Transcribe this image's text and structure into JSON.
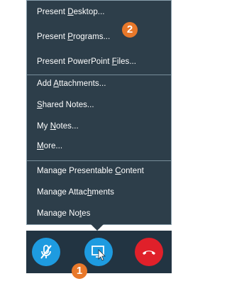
{
  "menu": {
    "items": [
      {
        "pre": "Present ",
        "acc": "D",
        "post": "esktop..."
      },
      {
        "pre": "Present ",
        "acc": "P",
        "post": "rograms..."
      },
      {
        "pre": "Present PowerPoint ",
        "acc": "F",
        "post": "iles..."
      },
      {
        "pre": "Add ",
        "acc": "A",
        "post": "ttachments..."
      },
      {
        "pre": "",
        "acc": "S",
        "post": "hared Notes..."
      },
      {
        "pre": "My ",
        "acc": "N",
        "post": "otes..."
      },
      {
        "pre": "",
        "acc": "M",
        "post": "ore..."
      },
      {
        "pre": "Manage Presentable ",
        "acc": "C",
        "post": "ontent"
      },
      {
        "pre": "Manage Attac",
        "acc": "h",
        "post": "ments"
      },
      {
        "pre": "Manage No",
        "acc": "t",
        "post": "es"
      }
    ]
  },
  "callouts": {
    "menu_step": "2",
    "button_step": "1"
  },
  "toolbar": {
    "mute_icon": "microphone-muted-icon",
    "present_icon": "present-screen-icon",
    "hangup_icon": "phone-hangup-icon"
  },
  "colors": {
    "menu_bg": "#2d3e4a",
    "toolbar_bg": "#223442",
    "accent_blue": "#1e9be0",
    "hangup_red": "#e0202a",
    "callout_orange": "#e8782a"
  }
}
